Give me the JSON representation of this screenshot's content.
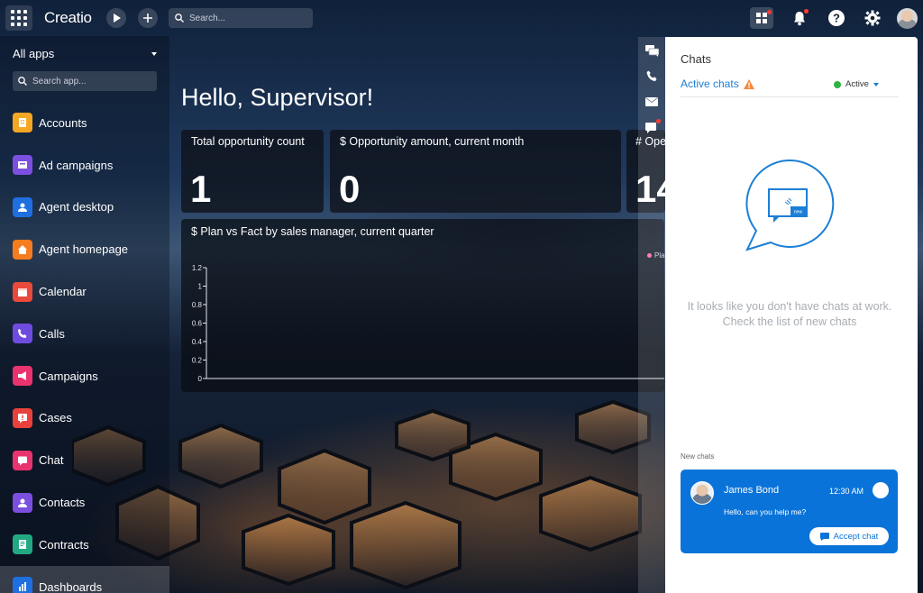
{
  "header": {
    "logo": "Creatio",
    "search_placeholder": "Search..."
  },
  "sidebar": {
    "all_apps_label": "All apps",
    "search_placeholder": "Search app...",
    "items": [
      {
        "label": "Accounts",
        "icon": "accounts-icon",
        "color": "#f5a623"
      },
      {
        "label": "Ad campaigns",
        "icon": "ad-campaigns-icon",
        "color": "#7b4fe0"
      },
      {
        "label": "Agent desktop",
        "icon": "agent-desktop-icon",
        "color": "#1f6fe0"
      },
      {
        "label": "Agent homepage",
        "icon": "home-icon",
        "color": "#f57c1f"
      },
      {
        "label": "Calendar",
        "icon": "calendar-icon",
        "color": "#e84a3c"
      },
      {
        "label": "Calls",
        "icon": "phone-icon",
        "color": "#6f4be0"
      },
      {
        "label": "Campaigns",
        "icon": "megaphone-icon",
        "color": "#e8336e"
      },
      {
        "label": "Cases",
        "icon": "cases-icon",
        "color": "#e8413c"
      },
      {
        "label": "Chat",
        "icon": "chat-icon",
        "color": "#e8336e"
      },
      {
        "label": "Contacts",
        "icon": "contacts-icon",
        "color": "#7b4fe0"
      },
      {
        "label": "Contracts",
        "icon": "contracts-icon",
        "color": "#23a884"
      },
      {
        "label": "Dashboards",
        "icon": "dashboards-icon",
        "color": "#1f6fe0"
      }
    ],
    "selected": "Dashboards"
  },
  "main": {
    "greeting": "Hello, Supervisor!",
    "cards": [
      {
        "label": "Total opportunity count",
        "value": "1"
      },
      {
        "label": "$ Opportunity amount, current month",
        "value": "0"
      },
      {
        "label": "# Ope",
        "value": "14"
      }
    ],
    "chart_title": "$ Plan vs Fact by sales manager, current quarter",
    "legend_label": "Pla"
  },
  "chart_data": {
    "type": "bar",
    "title": "$ Plan vs Fact by sales manager, current quarter",
    "categories": [],
    "series": [
      {
        "name": "Pla",
        "values": []
      }
    ],
    "yticks": [
      "0",
      "0.2",
      "0.4",
      "0.6",
      "0.8",
      "1",
      "1.2"
    ],
    "ylim": [
      0,
      1.2
    ],
    "xlabel": "",
    "ylabel": "",
    "series_color": "#ff6aa3"
  },
  "chats_panel": {
    "title": "Chats",
    "active_chats_label": "Active chats",
    "status_label": "Active",
    "empty_text": "It looks like you don't have chats at work. Check the list of new chats",
    "new_chats_label": "New chats",
    "chat": {
      "name": "James Bond",
      "time": "12:30 AM",
      "message": "Hello, can you help me?",
      "accept_label": "Accept chat"
    },
    "illustration_badge": "new"
  },
  "colors": {
    "accent": "#1c7fd6",
    "chat_card": "#0a73d9",
    "status_green": "#2fb344",
    "warning": "#f5883b"
  }
}
